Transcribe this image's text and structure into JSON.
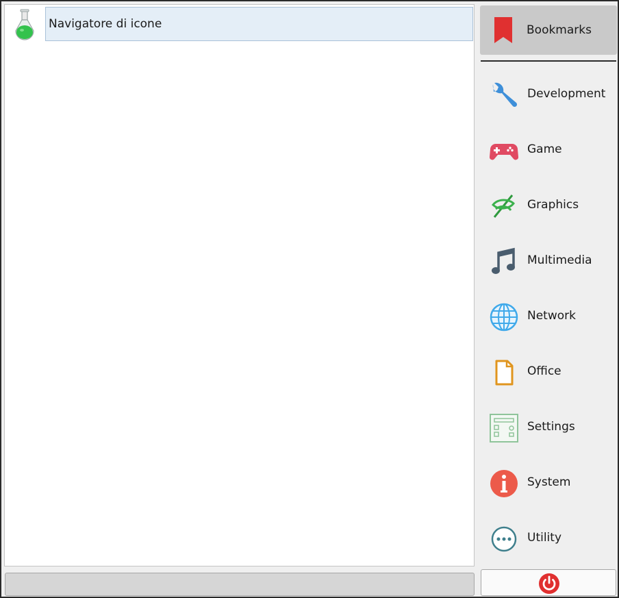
{
  "app_list": {
    "items": [
      {
        "label": "Navigatore di icone",
        "icon": "flask-icon"
      }
    ]
  },
  "categories": {
    "bookmarks": {
      "label": "Bookmarks",
      "icon": "bookmark-icon",
      "color": "#e03030"
    },
    "items": [
      {
        "label": "Development",
        "icon": "wrench-icon"
      },
      {
        "label": "Game",
        "icon": "gamepad-icon"
      },
      {
        "label": "Graphics",
        "icon": "graphics-icon"
      },
      {
        "label": "Multimedia",
        "icon": "music-note-icon"
      },
      {
        "label": "Network",
        "icon": "globe-icon"
      },
      {
        "label": "Office",
        "icon": "document-icon"
      },
      {
        "label": "Settings",
        "icon": "settings-panel-icon"
      },
      {
        "label": "System",
        "icon": "info-icon"
      },
      {
        "label": "Utility",
        "icon": "more-dots-icon"
      }
    ]
  },
  "footer": {
    "power_icon": "power-icon",
    "power_color": "#e03030"
  }
}
